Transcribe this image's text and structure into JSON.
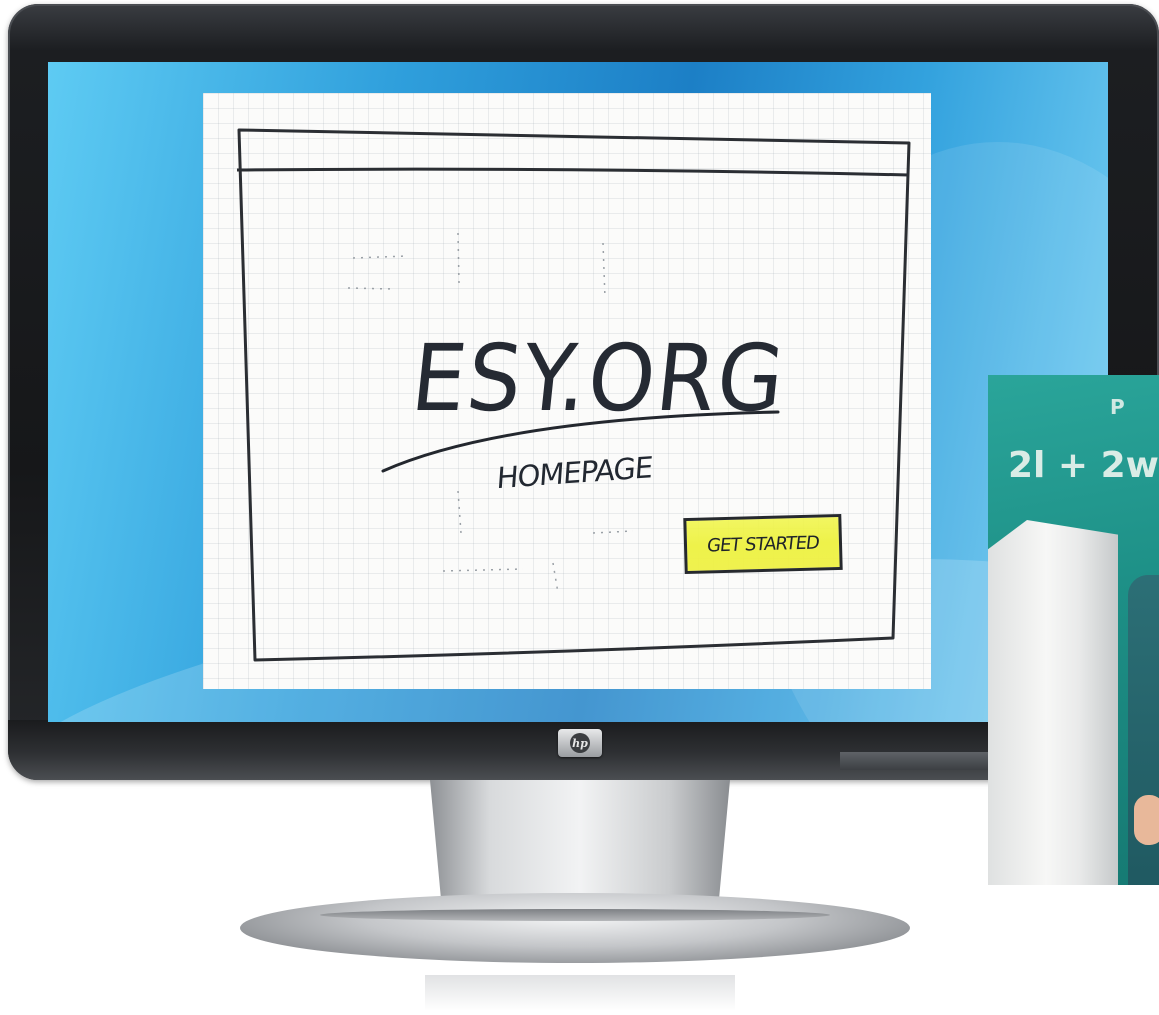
{
  "monitor": {
    "brand_logo": "hp",
    "brand_logo_icon": "hp-logo-icon"
  },
  "sketch": {
    "site_name": "ESY.ORG",
    "page_label": "HOMEPAGE",
    "cta_label": "GET STARTED",
    "highlight_color": "#eef24a"
  },
  "photo": {
    "chalkboard_text": "2l + 2w",
    "chalkboard_corner_text": "P"
  },
  "colors": {
    "screen_blue": "#2f9fdc",
    "bezel": "#161719",
    "chalkboard": "#1d8f86"
  }
}
